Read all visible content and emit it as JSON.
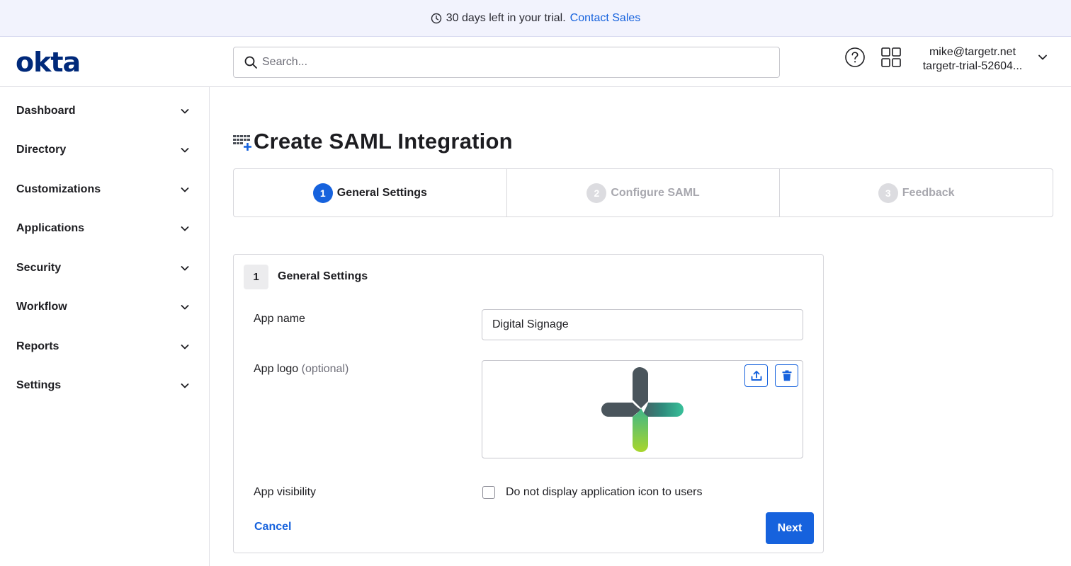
{
  "banner": {
    "message": "30 days left in your trial.",
    "link": "Contact Sales"
  },
  "header": {
    "logo": "okta",
    "search_placeholder": "Search...",
    "user_email": "mike@targetr.net",
    "user_org": "targetr-trial-52604..."
  },
  "sidebar": {
    "items": [
      {
        "label": "Dashboard"
      },
      {
        "label": "Directory"
      },
      {
        "label": "Customizations"
      },
      {
        "label": "Applications"
      },
      {
        "label": "Security"
      },
      {
        "label": "Workflow"
      },
      {
        "label": "Reports"
      },
      {
        "label": "Settings"
      }
    ]
  },
  "page": {
    "title": "Create SAML Integration"
  },
  "steps": [
    {
      "number": "1",
      "label": "General Settings",
      "state": "active"
    },
    {
      "number": "2",
      "label": "Configure SAML",
      "state": "inactive"
    },
    {
      "number": "3",
      "label": "Feedback",
      "state": "inactive"
    }
  ],
  "form": {
    "section_number": "1",
    "section_title": "General Settings",
    "app_name_label": "App name",
    "app_name_value": "Digital Signage",
    "app_logo_label": "App logo",
    "app_logo_optional": "(optional)",
    "app_visibility_label": "App visibility",
    "visibility_checkbox_label": "Do not display application icon to users",
    "visibility_checked": false,
    "cancel_label": "Cancel",
    "next_label": "Next"
  },
  "colors": {
    "accent": "#1662dd",
    "logo": "#00297a",
    "banner_bg": "#f2f3fd",
    "inactive_step": "#a7a7ae"
  },
  "icons": {
    "banner": "clock-icon",
    "search": "search-icon",
    "help": "help-circle-icon",
    "apps": "app-grid-icon",
    "user_menu": "chevron-down-icon",
    "nav": "chevron-down-icon",
    "title": "app-add-icon",
    "upload": "upload-icon",
    "delete": "trash-icon"
  }
}
